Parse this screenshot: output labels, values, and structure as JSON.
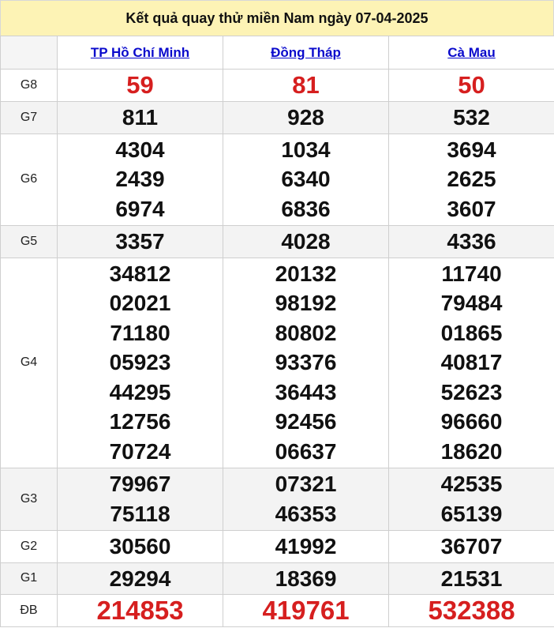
{
  "title": "Kết quả quay thử miền Nam ngày 07-04-2025",
  "provinces": [
    "TP Hồ Chí Minh",
    "Đồng Tháp",
    "Cà Mau"
  ],
  "rows": [
    {
      "label": "G8",
      "style": "red",
      "values": [
        [
          "59"
        ],
        [
          "81"
        ],
        [
          "50"
        ]
      ]
    },
    {
      "label": "G7",
      "style": "normal",
      "values": [
        [
          "811"
        ],
        [
          "928"
        ],
        [
          "532"
        ]
      ]
    },
    {
      "label": "G6",
      "style": "normal",
      "values": [
        [
          "4304",
          "2439",
          "6974"
        ],
        [
          "1034",
          "6340",
          "6836"
        ],
        [
          "3694",
          "2625",
          "3607"
        ]
      ]
    },
    {
      "label": "G5",
      "style": "normal",
      "values": [
        [
          "3357"
        ],
        [
          "4028"
        ],
        [
          "4336"
        ]
      ]
    },
    {
      "label": "G4",
      "style": "normal",
      "values": [
        [
          "34812",
          "02021",
          "71180",
          "05923",
          "44295",
          "12756",
          "70724"
        ],
        [
          "20132",
          "98192",
          "80802",
          "93376",
          "36443",
          "92456",
          "06637"
        ],
        [
          "11740",
          "79484",
          "01865",
          "40817",
          "52623",
          "96660",
          "18620"
        ]
      ]
    },
    {
      "label": "G3",
      "style": "normal",
      "values": [
        [
          "79967",
          "75118"
        ],
        [
          "07321",
          "46353"
        ],
        [
          "42535",
          "65139"
        ]
      ]
    },
    {
      "label": "G2",
      "style": "normal",
      "values": [
        [
          "30560"
        ],
        [
          "41992"
        ],
        [
          "36707"
        ]
      ]
    },
    {
      "label": "G1",
      "style": "normal",
      "values": [
        [
          "29294"
        ],
        [
          "18369"
        ],
        [
          "21531"
        ]
      ]
    },
    {
      "label": "ĐB",
      "style": "big",
      "values": [
        [
          "214853"
        ],
        [
          "419761"
        ],
        [
          "532388"
        ]
      ]
    }
  ]
}
